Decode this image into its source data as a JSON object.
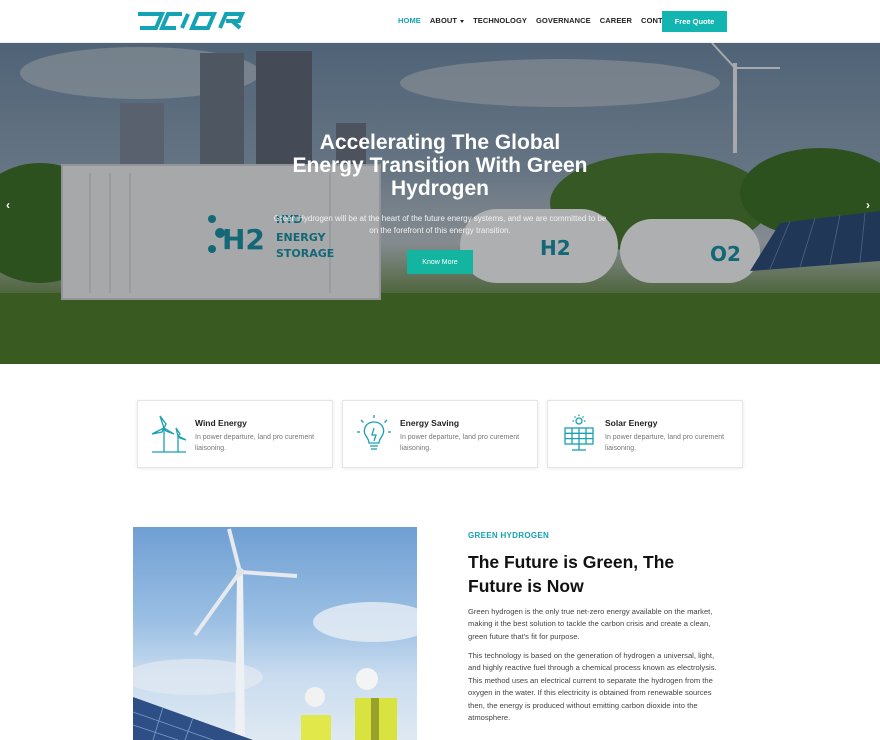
{
  "brand": {
    "logo_text": "OCIOR",
    "accent": "#13a3b4",
    "button_color": "#13b5b0"
  },
  "nav": {
    "items": [
      {
        "label": "HOME",
        "active": true
      },
      {
        "label": "ABOUT",
        "dropdown": true
      },
      {
        "label": "TECHNOLOGY"
      },
      {
        "label": "GOVERNANCE"
      },
      {
        "label": "CAREER"
      },
      {
        "label": "CONTACT"
      }
    ],
    "cta_label": "Free Quote"
  },
  "hero": {
    "title_lines": [
      "Accelerating The Global",
      "Energy Transition With Green",
      "Hydrogen"
    ],
    "subtitle": "Green Hydrogen will be at the heart of the future energy systems, and we are committed to be on the forefront of this energy transition.",
    "button_label": "Know More",
    "scene_labels": [
      "HYD",
      "ENERGY",
      "STORAGE",
      "H2",
      "O2"
    ],
    "prev_icon": "chevron-left-icon",
    "next_icon": "chevron-right-icon"
  },
  "features": [
    {
      "icon": "wind-turbine-icon",
      "title": "Wind Energy",
      "description": "In power departure, land pro curement liaisoning."
    },
    {
      "icon": "lightbulb-icon",
      "title": "Energy Saving",
      "description": "In power departure, land pro curement liaisoning."
    },
    {
      "icon": "solar-panel-icon",
      "title": "Solar Energy",
      "description": "In power departure, land pro curement liaisoning."
    }
  ],
  "about": {
    "eyebrow": "GREEN HYDROGEN",
    "title_lines": [
      "The Future is Green, The",
      "Future is Now"
    ],
    "paragraph_1": "Green hydrogen is the only true net-zero energy available on the market, making it the best solution to tackle the carbon crisis and create a clean, green future that's fit for purpose.",
    "paragraph_2": "This technology is based on the generation of hydrogen a universal, light, and highly reactive fuel through a chemical process known as electrolysis. This method uses an electrical current to separate the hydrogen from the oxygen in the water. If this electricity is obtained from renewable sources then, the energy is produced without emitting carbon dioxide into the atmosphere."
  }
}
